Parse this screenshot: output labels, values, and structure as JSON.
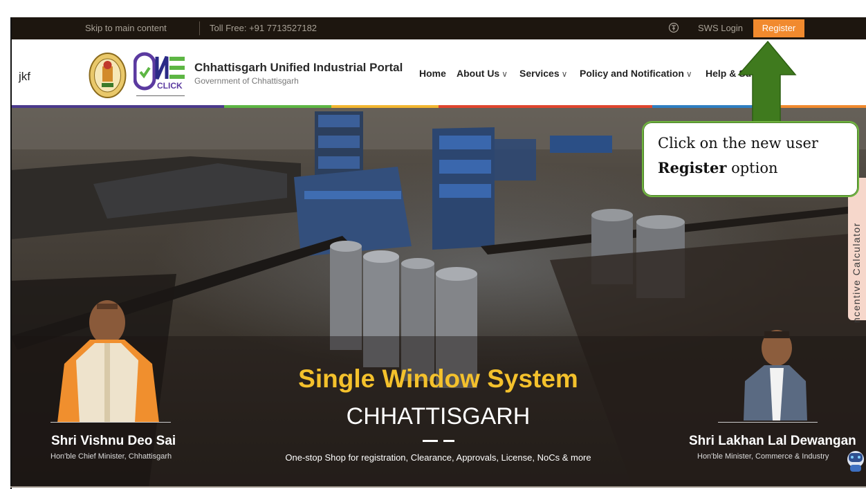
{
  "top_bar": {
    "skip_link": "Skip to main content",
    "toll_free": "Toll Free: +91 7713527182",
    "sws_login": "SWS Login",
    "register": "Register"
  },
  "header": {
    "stray_text": "jkf",
    "portal_title": "Chhattisgarh Unified Industrial Portal",
    "portal_subtitle": "Government of Chhattisgarh",
    "nav": [
      {
        "label": "Home"
      },
      {
        "label": "About Us",
        "chevron": "∨"
      },
      {
        "label": "Services",
        "chevron": "∨"
      },
      {
        "label": "Policy and Notification",
        "chevron": "∨"
      },
      {
        "label": "Help & Su"
      }
    ]
  },
  "hero": {
    "title": "Single Window System",
    "subtitle": "CHHATTISGARH",
    "tagline": "One-stop Shop for registration, Clearance, Approvals, License, NoCs & more",
    "left_person": {
      "name": "Shri Vishnu Deo Sai",
      "role": "Hon'ble Chief Minister, Chhattisgarh"
    },
    "right_person": {
      "name": "Shri Lakhan Lal Dewangan",
      "role": "Hon'ble Minister, Commerce & Industry"
    },
    "calculator_tab": "ncentive Calculator"
  },
  "annotation": {
    "text_before": "Click on the new user",
    "text_bold": "Register",
    "text_after": " option"
  },
  "colors": {
    "accent_orange": "#f18a2e",
    "headline_yellow": "#f4c12c",
    "arrow_green": "#3f7a1e",
    "strip": [
      "#4b3a8c",
      "#4b3a8c",
      "#5db644",
      "#f2b630",
      "#e0452e",
      "#e0452e",
      "#2f7fc2",
      "#f18a2e"
    ]
  },
  "icons": {
    "sws_login": "user-circle-icon",
    "chatbot": "robot-icon"
  }
}
